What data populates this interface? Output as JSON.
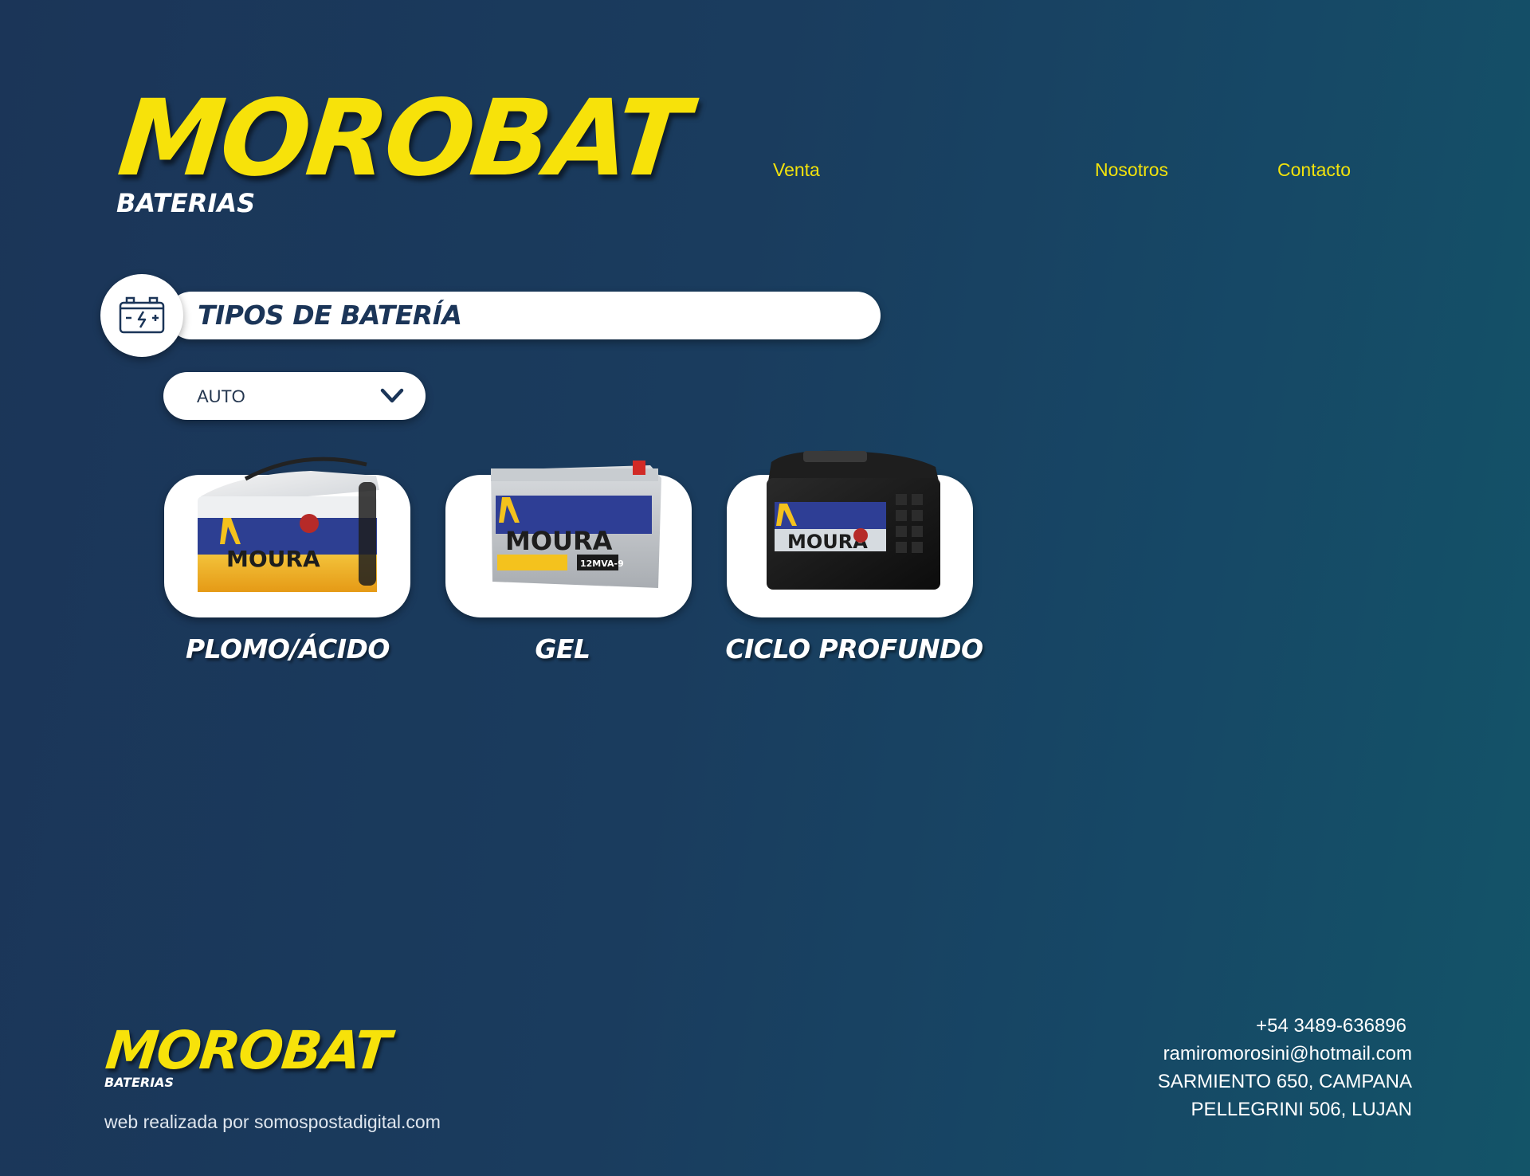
{
  "header": {
    "logo": {
      "brand": "MOROBAT",
      "tagline": "BATERIAS"
    },
    "nav": [
      {
        "label": "Venta"
      },
      {
        "label": "Nosotros"
      },
      {
        "label": "Contacto"
      }
    ]
  },
  "section": {
    "title": "TIPOS DE BATERÍA",
    "icon": "battery-icon"
  },
  "filter": {
    "selected": "AUTO",
    "icon": "chevron-down-icon"
  },
  "products": [
    {
      "label": "PLOMO/ÁCIDO",
      "brand_on_image": "MOURA"
    },
    {
      "label": "GEL",
      "brand_on_image": "MOURA",
      "model_on_image": "12MVA-9"
    },
    {
      "label": "CICLO PROFUNDO",
      "brand_on_image": "MOURA"
    }
  ],
  "footer": {
    "logo": {
      "brand": "MOROBAT",
      "tagline": "BATERIAS"
    },
    "credit": "web realizada por somospostadigital.com",
    "contact": {
      "phone": "+54 3489-636896",
      "email": "ramiromorosini@hotmail.com",
      "address_1": "SARMIENTO 650, CAMPANA",
      "address_2": "PELLEGRINI 506, LUJAN"
    }
  },
  "colors": {
    "accent_yellow": "#f7e20a",
    "background_dark": "#1b3558",
    "background_teal": "#135468",
    "card_white": "#ffffff"
  }
}
